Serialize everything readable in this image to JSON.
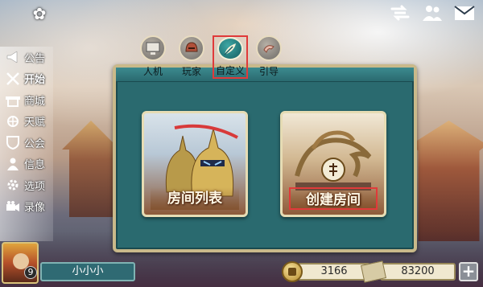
{
  "sidebar": {
    "items": [
      {
        "label": "公告",
        "icon": "megaphone-icon"
      },
      {
        "label": "开始",
        "icon": "crossed-swords-icon",
        "active": true
      },
      {
        "label": "商城",
        "icon": "shop-icon"
      },
      {
        "label": "天赋",
        "icon": "talent-icon"
      },
      {
        "label": "公会",
        "icon": "guild-shield-icon"
      },
      {
        "label": "信息",
        "icon": "person-icon"
      },
      {
        "label": "选项",
        "icon": "gear-icon"
      },
      {
        "label": "录像",
        "icon": "camera-icon"
      }
    ]
  },
  "tabs": [
    {
      "label": "人机",
      "icon": "computer-icon"
    },
    {
      "label": "玩家",
      "icon": "helmet-icon"
    },
    {
      "label": "自定义",
      "icon": "feather-quill-icon",
      "active": true
    },
    {
      "label": "引导",
      "icon": "hand-pointer-icon"
    }
  ],
  "cards": {
    "room_list": "房间列表",
    "create_room": "创建房间"
  },
  "player": {
    "name": "小小小",
    "level": "9"
  },
  "resources": {
    "gold": "3166",
    "tickets": "83200"
  },
  "colors": {
    "panel": "#2a6a6f",
    "panel_border": "#c9b98a",
    "highlight": "#e03a3a"
  }
}
